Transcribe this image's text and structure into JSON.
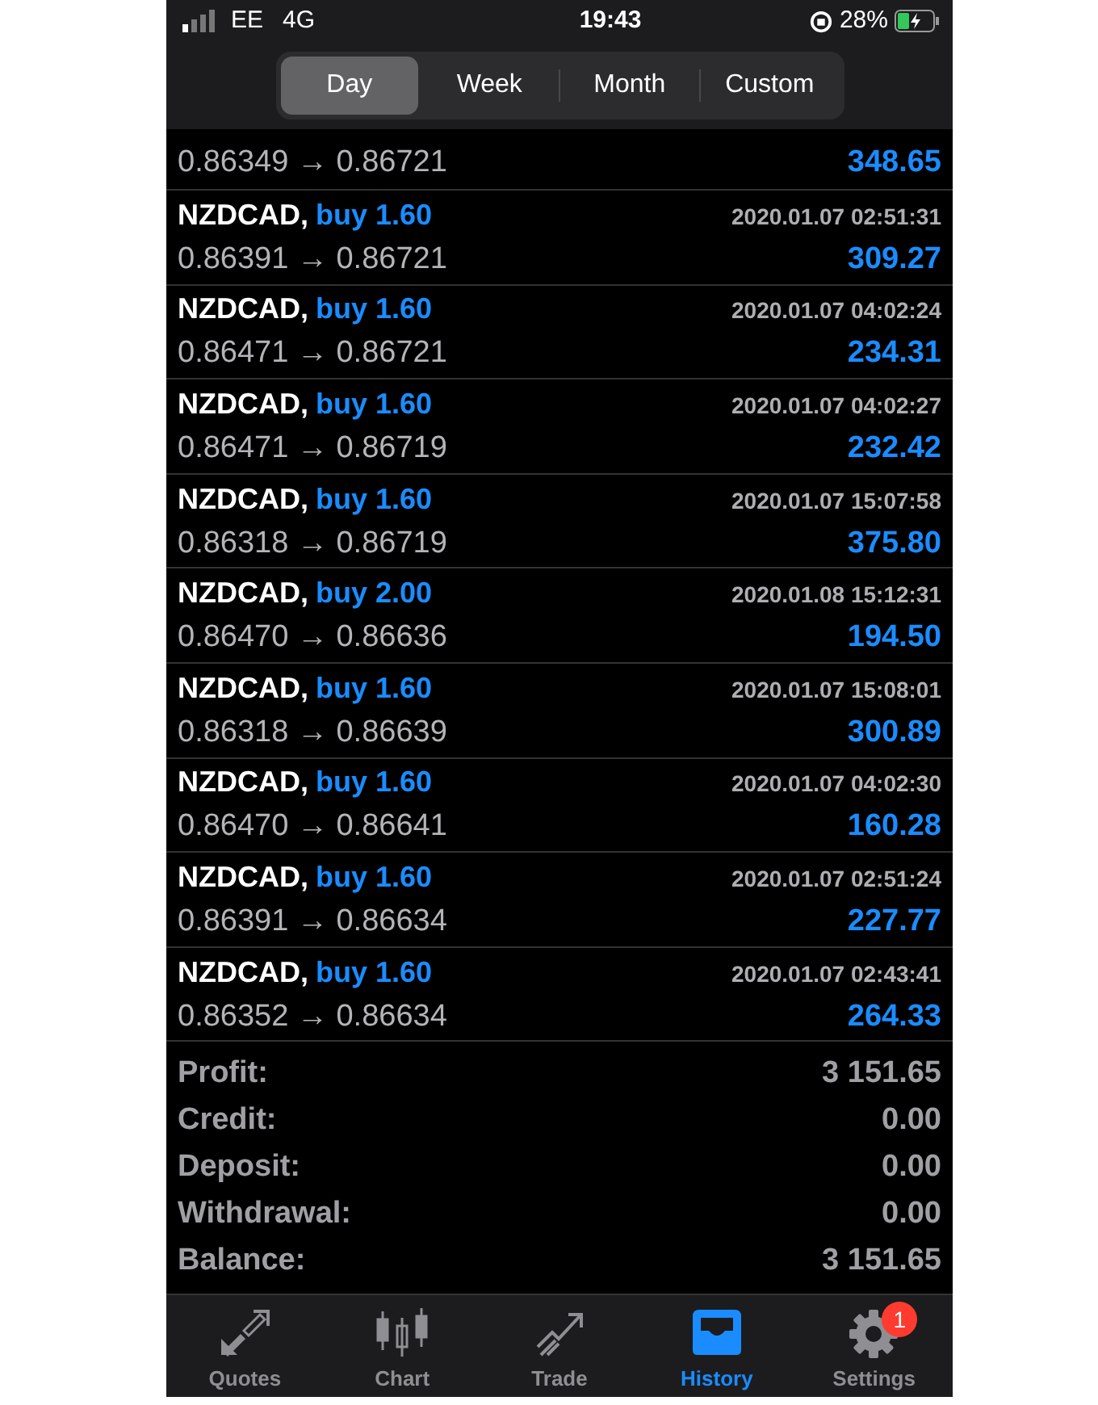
{
  "status_bar": {
    "carrier": "EE",
    "network": "4G",
    "time": "19:43",
    "battery": "28%"
  },
  "periods": [
    {
      "label": "Day",
      "selected": true
    },
    {
      "label": "Week",
      "selected": false
    },
    {
      "label": "Month",
      "selected": false
    },
    {
      "label": "Custom",
      "selected": false
    }
  ],
  "partial_deal": {
    "prices": "0.86349 → 0.86721",
    "profit": "348.65"
  },
  "deals": [
    {
      "symbol": "NZDCAD,",
      "trade": "buy 1.60",
      "time": "2020.01.07 02:51:31",
      "prices": "0.86391 → 0.86721",
      "profit": "309.27"
    },
    {
      "symbol": "NZDCAD,",
      "trade": "buy 1.60",
      "time": "2020.01.07 04:02:24",
      "prices": "0.86471 → 0.86721",
      "profit": "234.31"
    },
    {
      "symbol": "NZDCAD,",
      "trade": "buy 1.60",
      "time": "2020.01.07 04:02:27",
      "prices": "0.86471 → 0.86719",
      "profit": "232.42"
    },
    {
      "symbol": "NZDCAD,",
      "trade": "buy 1.60",
      "time": "2020.01.07 15:07:58",
      "prices": "0.86318 → 0.86719",
      "profit": "375.80"
    },
    {
      "symbol": "NZDCAD,",
      "trade": "buy 2.00",
      "time": "2020.01.08 15:12:31",
      "prices": "0.86470 → 0.86636",
      "profit": "194.50"
    },
    {
      "symbol": "NZDCAD,",
      "trade": "buy 1.60",
      "time": "2020.01.07 15:08:01",
      "prices": "0.86318 → 0.86639",
      "profit": "300.89"
    },
    {
      "symbol": "NZDCAD,",
      "trade": "buy 1.60",
      "time": "2020.01.07 04:02:30",
      "prices": "0.86470 → 0.86641",
      "profit": "160.28"
    },
    {
      "symbol": "NZDCAD,",
      "trade": "buy 1.60",
      "time": "2020.01.07 02:51:24",
      "prices": "0.86391 → 0.86634",
      "profit": "227.77"
    },
    {
      "symbol": "NZDCAD,",
      "trade": "buy 1.60",
      "time": "2020.01.07 02:43:41",
      "prices": "0.86352 → 0.86634",
      "profit": "264.33"
    }
  ],
  "summary": [
    {
      "label": "Profit:",
      "value": "3 151.65"
    },
    {
      "label": "Credit:",
      "value": "0.00"
    },
    {
      "label": "Deposit:",
      "value": "0.00"
    },
    {
      "label": "Withdrawal:",
      "value": "0.00"
    },
    {
      "label": "Balance:",
      "value": "3 151.65"
    }
  ],
  "tab_bar": [
    {
      "kind": "quotes",
      "label": "Quotes",
      "selected": false
    },
    {
      "kind": "chart",
      "label": "Chart",
      "selected": false
    },
    {
      "kind": "trade",
      "label": "Trade",
      "selected": false
    },
    {
      "kind": "history",
      "label": "History",
      "selected": true
    },
    {
      "kind": "settings",
      "label": "Settings",
      "selected": false,
      "badge": "1"
    }
  ]
}
